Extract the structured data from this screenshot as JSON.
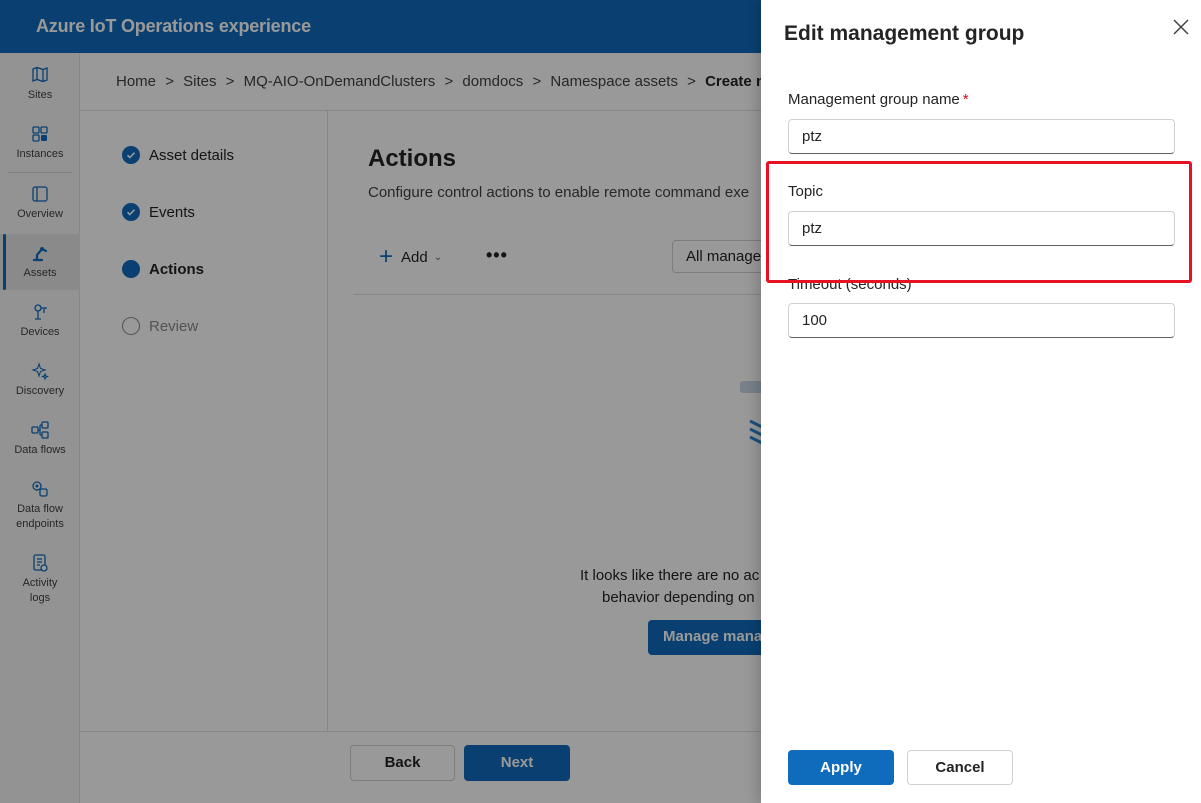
{
  "app": {
    "title": "Azure IoT Operations experience"
  },
  "nav": [
    {
      "label": "Sites",
      "icon": "map-icon"
    },
    {
      "label": "Instances",
      "icon": "instances-icon"
    },
    {
      "label": "Overview",
      "icon": "overview-icon"
    },
    {
      "label": "Assets",
      "icon": "robot-arm-icon",
      "selected": true
    },
    {
      "label": "Devices",
      "icon": "device-icon"
    },
    {
      "label": "Discovery",
      "icon": "sparkle-icon"
    },
    {
      "label": "Data flows",
      "icon": "dataflow-icon"
    },
    {
      "label": "Data flow endpoints",
      "icon": "endpoint-icon"
    },
    {
      "label": "Activity logs",
      "icon": "activity-log-icon"
    }
  ],
  "breadcrumb": [
    "Home",
    ">",
    "Sites",
    ">",
    "MQ-AIO-OnDemandClusters",
    ">",
    "domdocs",
    ">",
    "Namespace assets",
    ">"
  ],
  "breadcrumb_current": "Create names",
  "steps": [
    {
      "label": "Asset details",
      "state": "done"
    },
    {
      "label": "Events",
      "state": "done"
    },
    {
      "label": "Actions",
      "state": "current"
    },
    {
      "label": "Review",
      "state": "pending"
    }
  ],
  "main": {
    "title": "Actions",
    "description": "Configure control actions to enable remote command exe",
    "add_label": "Add",
    "more_label": "•••",
    "filter_label": "All manage",
    "empty_line1": "It looks like there are no ac",
    "empty_line2": "behavior depending on",
    "manage_label": "Manage mana"
  },
  "footer": {
    "back_label": "Back",
    "next_label": "Next"
  },
  "drawer": {
    "title": "Edit management group",
    "group_name_label": "Management group name",
    "required_mark": "*",
    "group_name_value": "ptz",
    "topic_label": "Topic",
    "topic_value": "ptz",
    "timeout_label": "Timeout (seconds)",
    "timeout_value": "100",
    "apply_label": "Apply",
    "cancel_label": "Cancel"
  },
  "colors": {
    "brand": "#0f6cbd",
    "highlight": "#e81123",
    "required": "#c50f1f"
  }
}
